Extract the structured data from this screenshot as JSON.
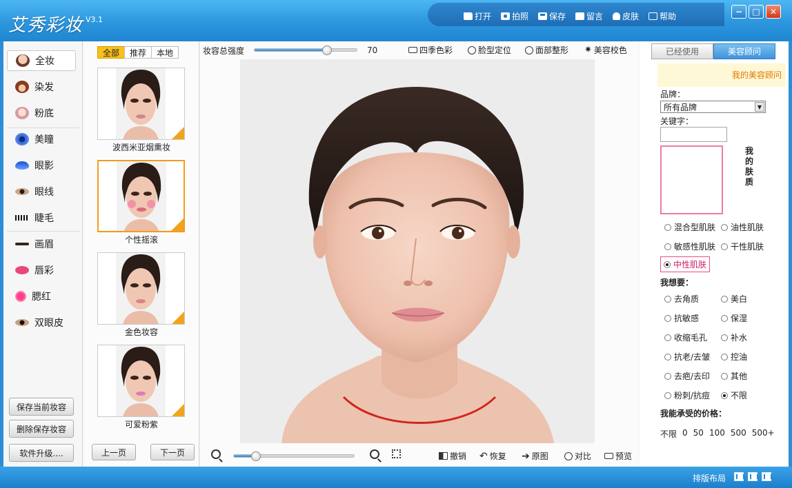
{
  "app": {
    "title": "艾秀彩妆",
    "version": "V3.1"
  },
  "toolbar": {
    "open": "打开",
    "photo": "拍照",
    "save": "保存",
    "message": "留言",
    "skin": "皮肤",
    "help": "帮助"
  },
  "categories": [
    "全妆",
    "染发",
    "粉底",
    "美瞳",
    "眼影",
    "眼线",
    "睫毛",
    "画眉",
    "唇彩",
    "腮红",
    "双眼皮"
  ],
  "side_buttons": {
    "save_current": "保存当前妆容",
    "delete_saved": "删除保存妆容",
    "upgrade": "软件升级...."
  },
  "filters": [
    "全部",
    "推荐",
    "本地"
  ],
  "looks": [
    {
      "label": "波西米亚烟熏妆",
      "lip": "#c98a8a"
    },
    {
      "label": "个性摇滚",
      "lip": "#d96a7a"
    },
    {
      "label": "金色妆容",
      "lip": "#d9838a"
    },
    {
      "label": "可爱粉紫",
      "lip": "#e07ab8"
    }
  ],
  "pager": {
    "prev": "上一页",
    "next": "下一页"
  },
  "intensity": {
    "label": "妆容总强度",
    "value": "70",
    "fraction": 0.7
  },
  "tools": {
    "four_seasons": "四季色彩",
    "face_locate": "脸型定位",
    "face_shape": "面部整形",
    "color_correct": "美容校色"
  },
  "bottom_tools": {
    "undo": "撤销",
    "redo": "恢复",
    "original": "原图",
    "compare": "对比",
    "preview": "预览"
  },
  "zoom": {
    "fraction": 0.18
  },
  "right": {
    "tabs": [
      "已经使用",
      "美容顾问"
    ],
    "advisor": "我的美容顾问",
    "brand_label": "品牌：",
    "brand_value": "所有品牌",
    "keyword_label": "关键字：",
    "skin_title": "我的肤质",
    "skin_types": [
      "混合型肌肤",
      "油性肌肤",
      "敏感性肌肤",
      "干性肌肤",
      "中性肌肤"
    ],
    "want_label": "我想要：",
    "wants": [
      "去角质",
      "美白",
      "抗敏感",
      "保湿",
      "收缩毛孔",
      "补水",
      "抗老/去皱",
      "控油",
      "去疤/去印",
      "其他",
      "粉刺/抗痘",
      "不限"
    ],
    "price_label": "我能承受的价格：",
    "prices": [
      "不限",
      "0",
      "50",
      "100",
      "500",
      "500+"
    ]
  },
  "status": {
    "layout_label": "排版布局"
  },
  "colors": {
    "titlebar": "#2c96de",
    "accent_orange": "#f39b1a",
    "filter_active": "#f7c11a",
    "advisor_text": "#e07700",
    "skin_highlight": "#ec4b8a"
  }
}
